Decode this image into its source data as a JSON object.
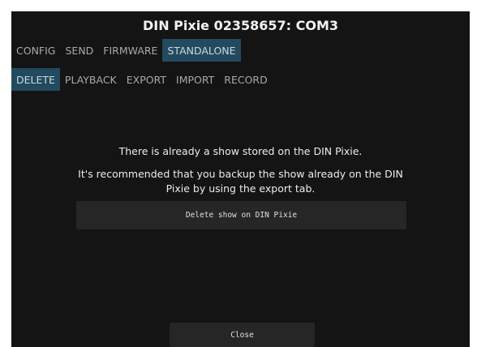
{
  "window": {
    "title": "DIN Pixie 02358657: COM3"
  },
  "tabs": {
    "main": [
      {
        "label": "CONFIG",
        "active": false
      },
      {
        "label": "SEND",
        "active": false
      },
      {
        "label": "FIRMWARE",
        "active": false
      },
      {
        "label": "STANDALONE",
        "active": true
      }
    ],
    "sub": [
      {
        "label": "DELETE",
        "active": true
      },
      {
        "label": "PLAYBACK",
        "active": false
      },
      {
        "label": "EXPORT",
        "active": false
      },
      {
        "label": "IMPORT",
        "active": false
      },
      {
        "label": "RECORD",
        "active": false
      }
    ]
  },
  "content": {
    "message_line1": "There is already a show stored on the DIN Pixie.",
    "message_line2": "It's recommended that you backup the show already on the DIN Pixie by using the export tab.",
    "delete_button_label": "Delete show on DIN Pixie"
  },
  "footer": {
    "close_label": "Close"
  },
  "colors": {
    "background": "#141414",
    "active_tab": "#234a5e",
    "button": "#262626"
  }
}
